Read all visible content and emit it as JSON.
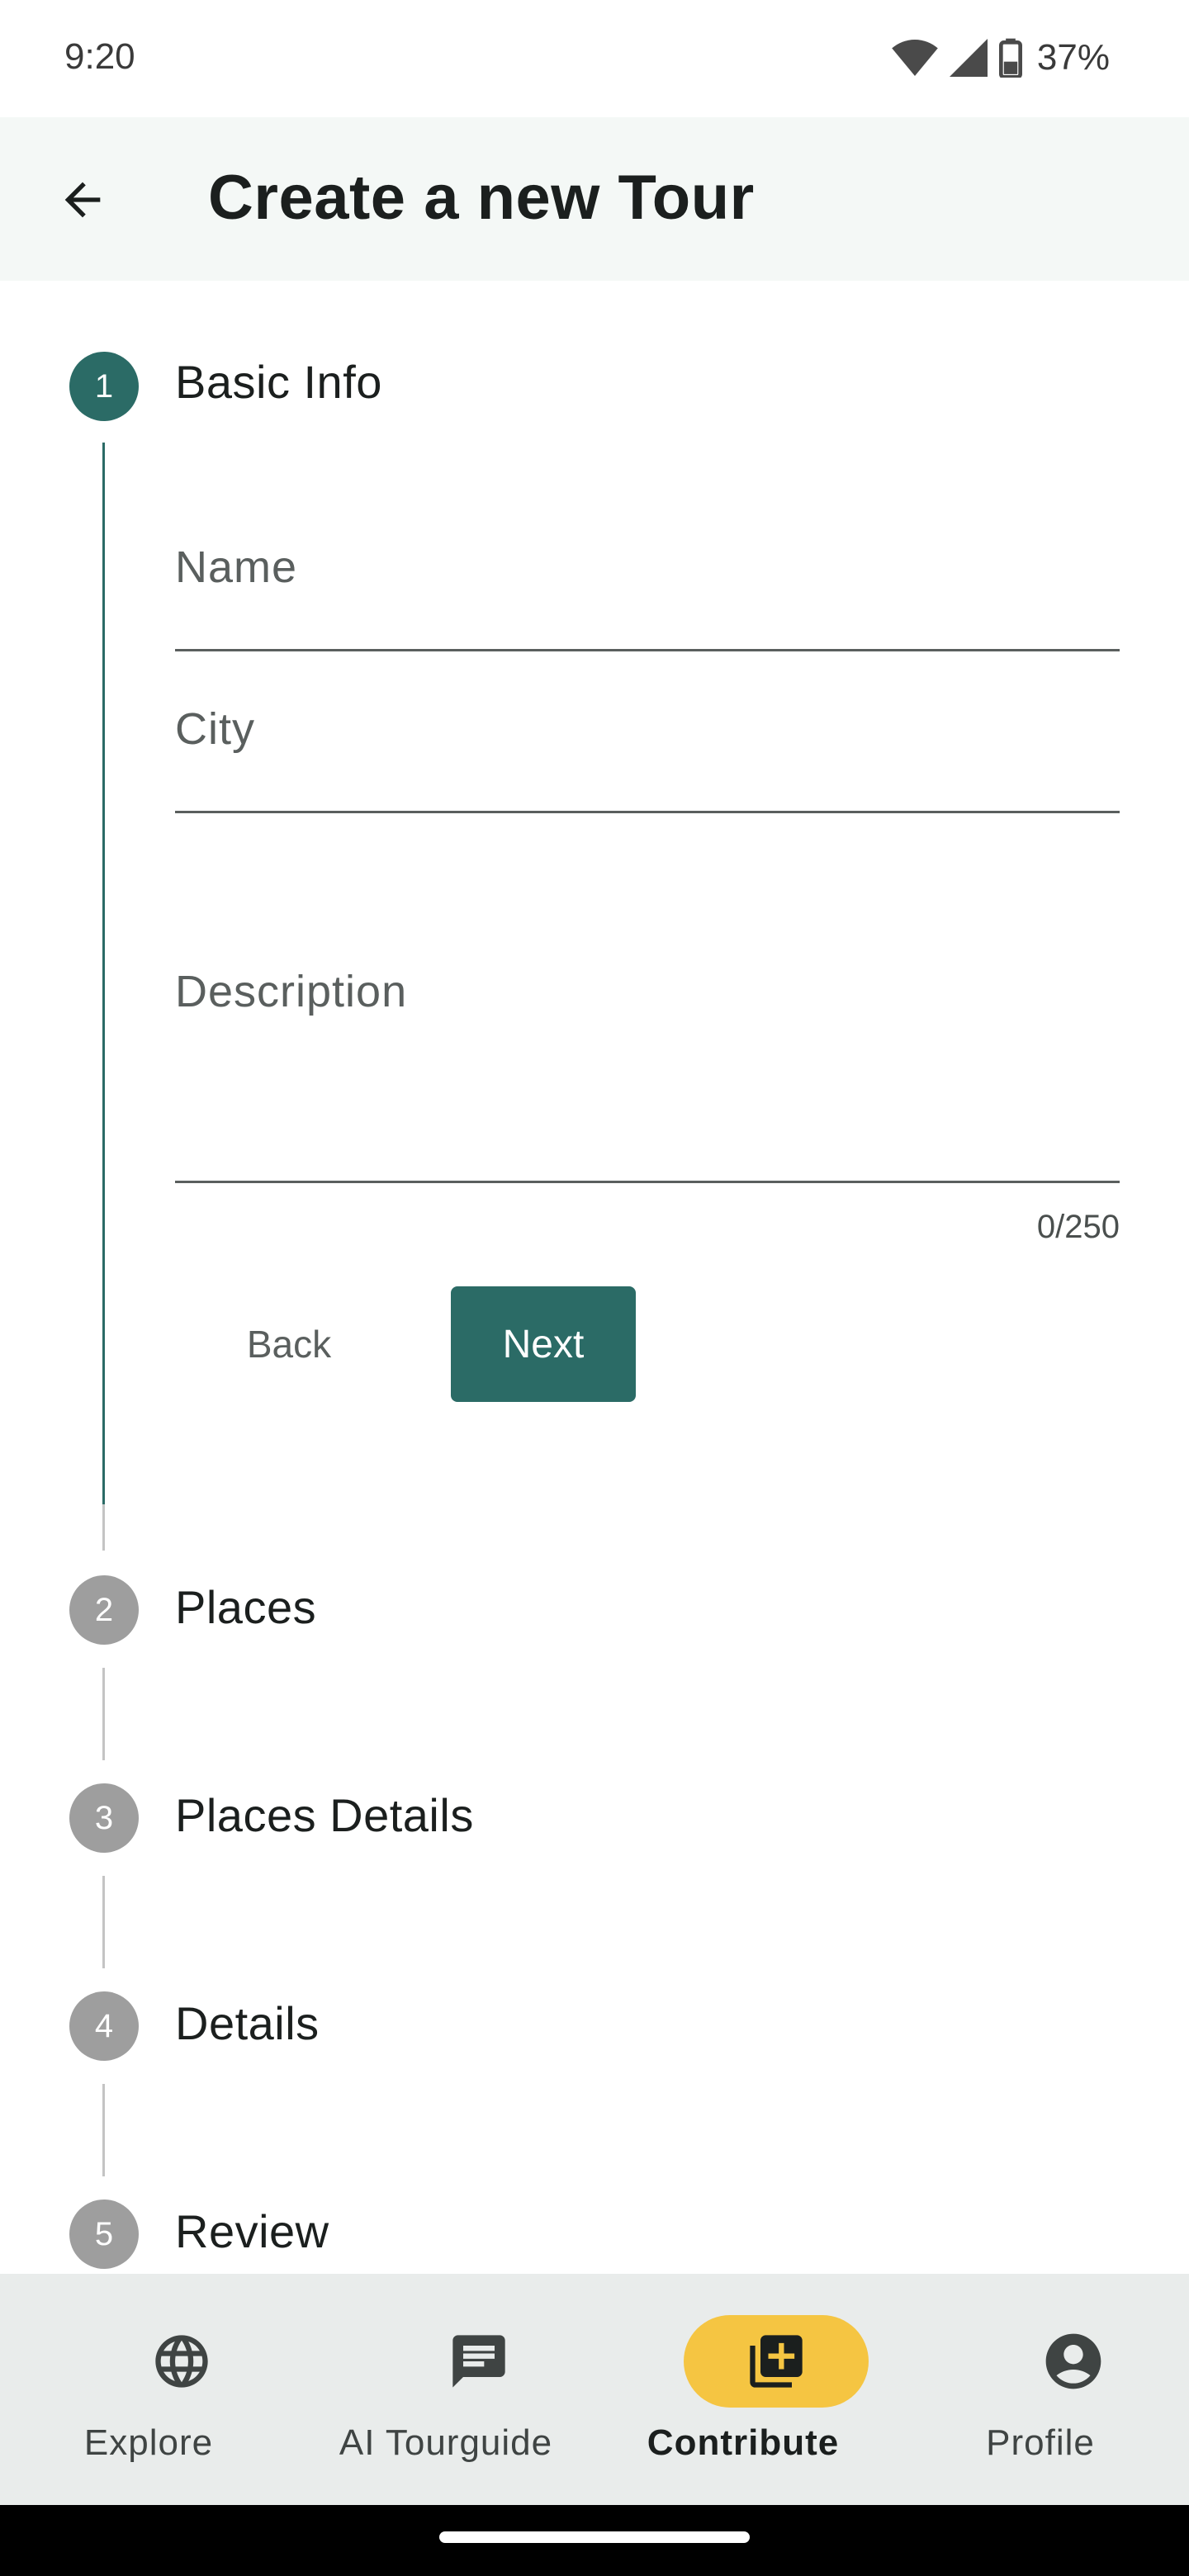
{
  "status_bar": {
    "time": "9:20",
    "battery": "37%"
  },
  "app_bar": {
    "title": "Create a new Tour"
  },
  "stepper": {
    "steps": [
      {
        "number": "1",
        "label": "Basic Info",
        "active": true
      },
      {
        "number": "2",
        "label": "Places",
        "active": false
      },
      {
        "number": "3",
        "label": "Places Details",
        "active": false
      },
      {
        "number": "4",
        "label": "Details",
        "active": false
      },
      {
        "number": "5",
        "label": "Review",
        "active": false
      }
    ]
  },
  "form": {
    "name_label": "Name",
    "city_label": "City",
    "description_label": "Description",
    "description_counter": "0/250",
    "back_label": "Back",
    "next_label": "Next"
  },
  "bottom_nav": {
    "items": [
      {
        "label": "Explore",
        "icon": "globe-icon",
        "selected": false
      },
      {
        "label": "AI Tourguide",
        "icon": "chat-icon",
        "selected": false
      },
      {
        "label": "Contribute",
        "icon": "add-box-icon",
        "selected": true
      },
      {
        "label": "Profile",
        "icon": "account-circle-icon",
        "selected": false
      }
    ]
  },
  "colors": {
    "primary": "#2b6b66",
    "accent": "#f5c542",
    "app_bar_bg": "#f4f8f6",
    "nav_bg": "#e9eceb",
    "inactive_step": "#9e9e9e"
  }
}
